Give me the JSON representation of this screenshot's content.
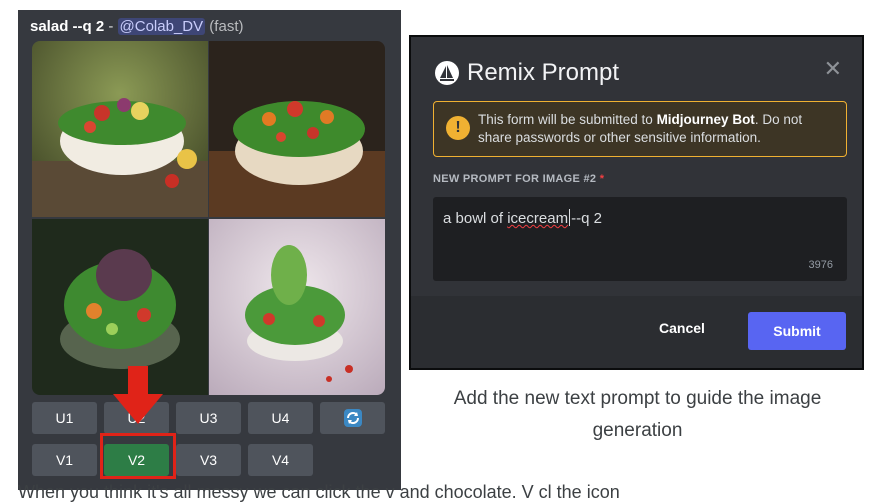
{
  "message": {
    "prompt": "salad --q 2",
    "separator": " - ",
    "mention": "@Colab_DV",
    "speed": " (fast)"
  },
  "buttons": {
    "upscale": [
      "U1",
      "U2",
      "U3",
      "U4"
    ],
    "variation": [
      "V1",
      "V2",
      "V3",
      "V4"
    ],
    "selected": "V2"
  },
  "icons": {
    "reroll": "refresh-icon",
    "bot": "sailboat-icon",
    "warning": "exclamation-icon",
    "close": "close-icon",
    "pointer": "red-arrow-down-icon"
  },
  "modal": {
    "title": "Remix Prompt",
    "close_glyph": "✕",
    "warning_icon": "!",
    "warning_pre": "This form will be submitted to ",
    "warning_bot": "Midjourney Bot",
    "warning_post": ". Do not share passwords or other sensitive information.",
    "field_label": "NEW PROMPT FOR IMAGE #2",
    "required_mark": "*",
    "prompt_pre": "a bowl of ",
    "prompt_misspelled": "icecream",
    "prompt_post": "--q 2",
    "char_count": "3976",
    "cancel_label": "Cancel",
    "submit_label": "Submit"
  },
  "caption": "Add the new text prompt to guide the image generation",
  "bottom_text": "When you think it's all messy we can click the v and chocolate. V cl the icon",
  "colors": {
    "discord_bg": "#36393f",
    "button_gray": "#4f545c",
    "button_green": "#2d7d46",
    "highlight_red": "#e02318",
    "blurple": "#5865f2",
    "warning_yellow": "#f0b132"
  }
}
